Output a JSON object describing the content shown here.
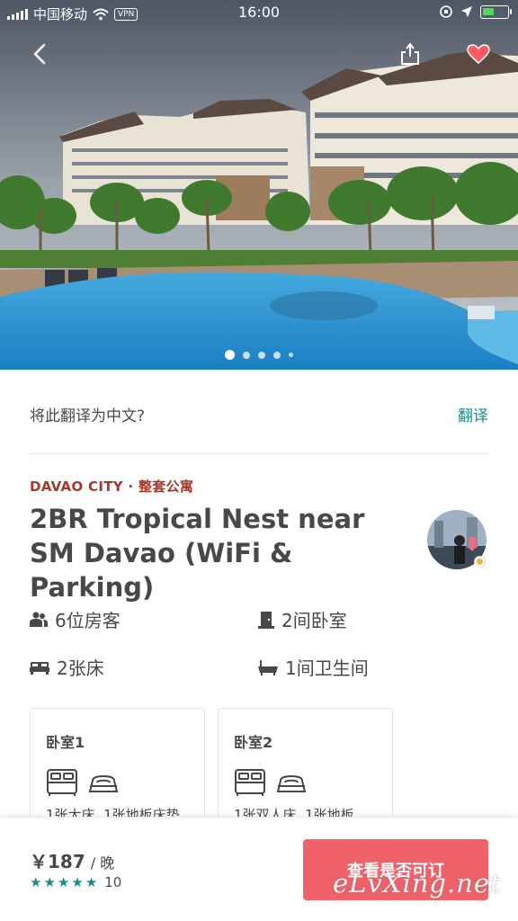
{
  "status_bar": {
    "carrier": "中国移动",
    "vpn": "VPN",
    "time": "16:00"
  },
  "hero": {
    "photo_count": 5,
    "active_index": 0,
    "back_icon": "chevron-left-icon",
    "share_icon": "share-icon",
    "favorite_icon": "heart-icon",
    "favorite_color": "#ff5a5f"
  },
  "translate": {
    "question": "将此翻译为中文?",
    "action": "翻译"
  },
  "listing": {
    "location": "DAVAO CITY · 整套公寓",
    "title": "2BR Tropical Nest near SM Davao (WiFi & Parking)",
    "accent_color": "#a3382a"
  },
  "amenities": {
    "guests": "6位房客",
    "bedrooms": "2间卧室",
    "beds": "2张床",
    "baths": "1间卫生间"
  },
  "rooms": [
    {
      "name": "卧室1",
      "desc": "1张大床, 1张地板床垫"
    },
    {
      "name": "卧室2",
      "desc": "1张双人床, 1张地板"
    }
  ],
  "booking": {
    "price": "￥187",
    "per": "/ 晚",
    "rating_stars": 5,
    "review_count": "10",
    "button_label": "查看是否可订",
    "button_color": "#f0616a"
  },
  "watermark": "eLvXing.net"
}
